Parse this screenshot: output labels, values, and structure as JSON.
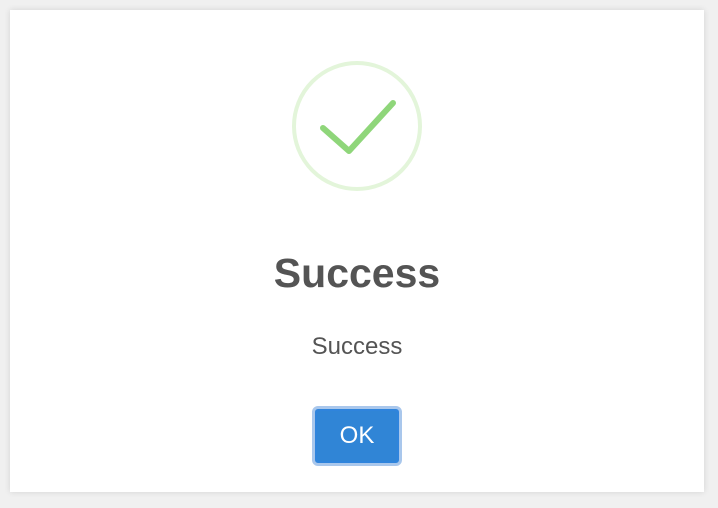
{
  "dialog": {
    "title": "Success",
    "message": "Success",
    "ok_label": "OK",
    "icon": "success-checkmark-icon"
  },
  "colors": {
    "icon_ring": "#e3f5da",
    "icon_check": "#8fd67a",
    "text": "#545454",
    "button": "#3085d6",
    "button_focus_ring": "#a9c7ec"
  }
}
